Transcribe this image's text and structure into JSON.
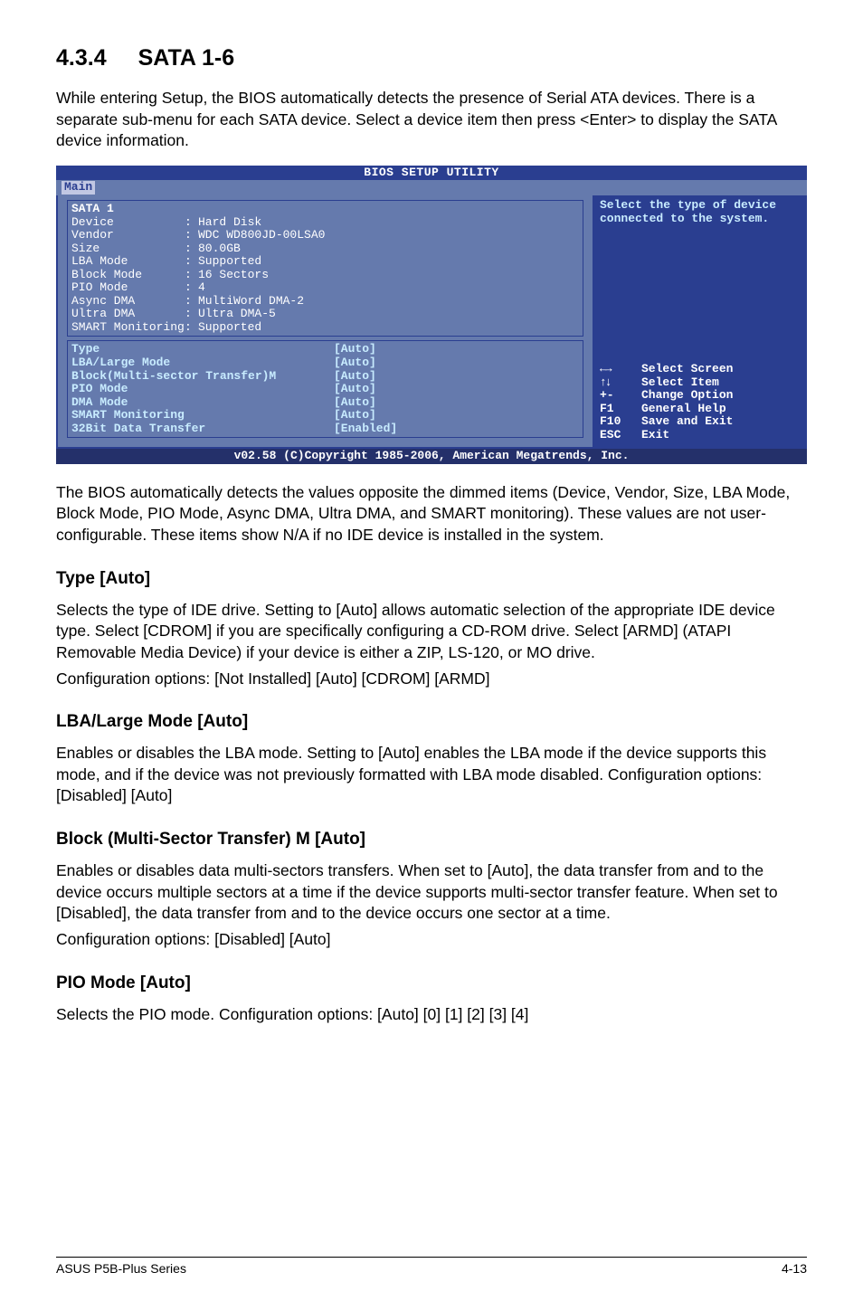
{
  "section": {
    "number": "4.3.4",
    "title": "SATA 1-6"
  },
  "intro": "While entering Setup, the BIOS automatically detects the presence of Serial ATA devices. There is a separate sub-menu for each SATA device. Select a device item then press <Enter> to display the SATA device information.",
  "bios": {
    "title": "BIOS SETUP UTILITY",
    "tab": "Main",
    "section_label": "SATA 1",
    "info_fields": [
      {
        "label": "Device",
        "value": "Hard Disk"
      },
      {
        "label": "Vendor",
        "value": "WDC WD800JD-00LSA0"
      },
      {
        "label": "Size",
        "value": "80.0GB"
      },
      {
        "label": "LBA Mode",
        "value": "Supported"
      },
      {
        "label": "Block Mode",
        "value": "16 Sectors"
      },
      {
        "label": "PIO Mode",
        "value": "4"
      },
      {
        "label": "Async DMA",
        "value": "MultiWord DMA-2"
      },
      {
        "label": "Ultra DMA",
        "value": "Ultra DMA-5"
      },
      {
        "label": "SMART Monitoring",
        "value": "Supported"
      }
    ],
    "settings": [
      {
        "label": "Type",
        "value": "[Auto]"
      },
      {
        "label": "LBA/Large Mode",
        "value": "[Auto]"
      },
      {
        "label": "Block(Multi-sector Transfer)M",
        "value": "[Auto]"
      },
      {
        "label": "PIO Mode",
        "value": "[Auto]"
      },
      {
        "label": "DMA Mode",
        "value": "[Auto]"
      },
      {
        "label": "SMART Monitoring",
        "value": "[Auto]"
      },
      {
        "label": "32Bit Data Transfer",
        "value": "[Enabled]"
      }
    ],
    "help_top": "Select the type of device connected to the system.",
    "help_keys": [
      {
        "key": "←→",
        "desc": "Select Screen"
      },
      {
        "key": "↑↓",
        "desc": "Select Item"
      },
      {
        "key": "+-",
        "desc": "Change Option"
      },
      {
        "key": "F1",
        "desc": "General Help"
      },
      {
        "key": "F10",
        "desc": "Save and Exit"
      },
      {
        "key": "ESC",
        "desc": "Exit"
      }
    ],
    "footer": "v02.58 (C)Copyright 1985-2006, American Megatrends, Inc."
  },
  "para_after_bios": "The BIOS automatically detects the values opposite the dimmed items (Device, Vendor, Size, LBA Mode, Block Mode, PIO Mode, Async DMA, Ultra DMA, and SMART monitoring). These values are not user-configurable. These items show N/A if no IDE device is installed in the system.",
  "type": {
    "heading": "Type [Auto]",
    "body1": "Selects the type of IDE drive. Setting to [Auto] allows automatic selection of the appropriate IDE device type. Select [CDROM] if you are specifically configuring a CD-ROM drive. Select [ARMD] (ATAPI Removable Media Device) if your device is either a ZIP, LS-120, or MO drive.",
    "body2": "Configuration options: [Not Installed] [Auto] [CDROM] [ARMD]"
  },
  "lba": {
    "heading": "LBA/Large Mode [Auto]",
    "body": "Enables or disables the LBA mode. Setting to [Auto] enables the LBA mode if the device supports this mode, and if the device was not previously formatted with LBA mode disabled. Configuration options: [Disabled] [Auto]"
  },
  "block": {
    "heading": "Block (Multi-Sector Transfer) M [Auto]",
    "body1": "Enables or disables data multi-sectors transfers. When set to [Auto], the data transfer from and to the device occurs multiple sectors at a time if the device supports multi-sector transfer feature. When set to [Disabled], the data transfer from and to the device occurs one sector at a time.",
    "body2": "Configuration options: [Disabled] [Auto]"
  },
  "pio": {
    "heading": "PIO Mode [Auto]",
    "body": "Selects the PIO mode. Configuration options: [Auto] [0] [1] [2] [3] [4]"
  },
  "footer": {
    "left": "ASUS P5B-Plus Series",
    "right": "4-13"
  }
}
